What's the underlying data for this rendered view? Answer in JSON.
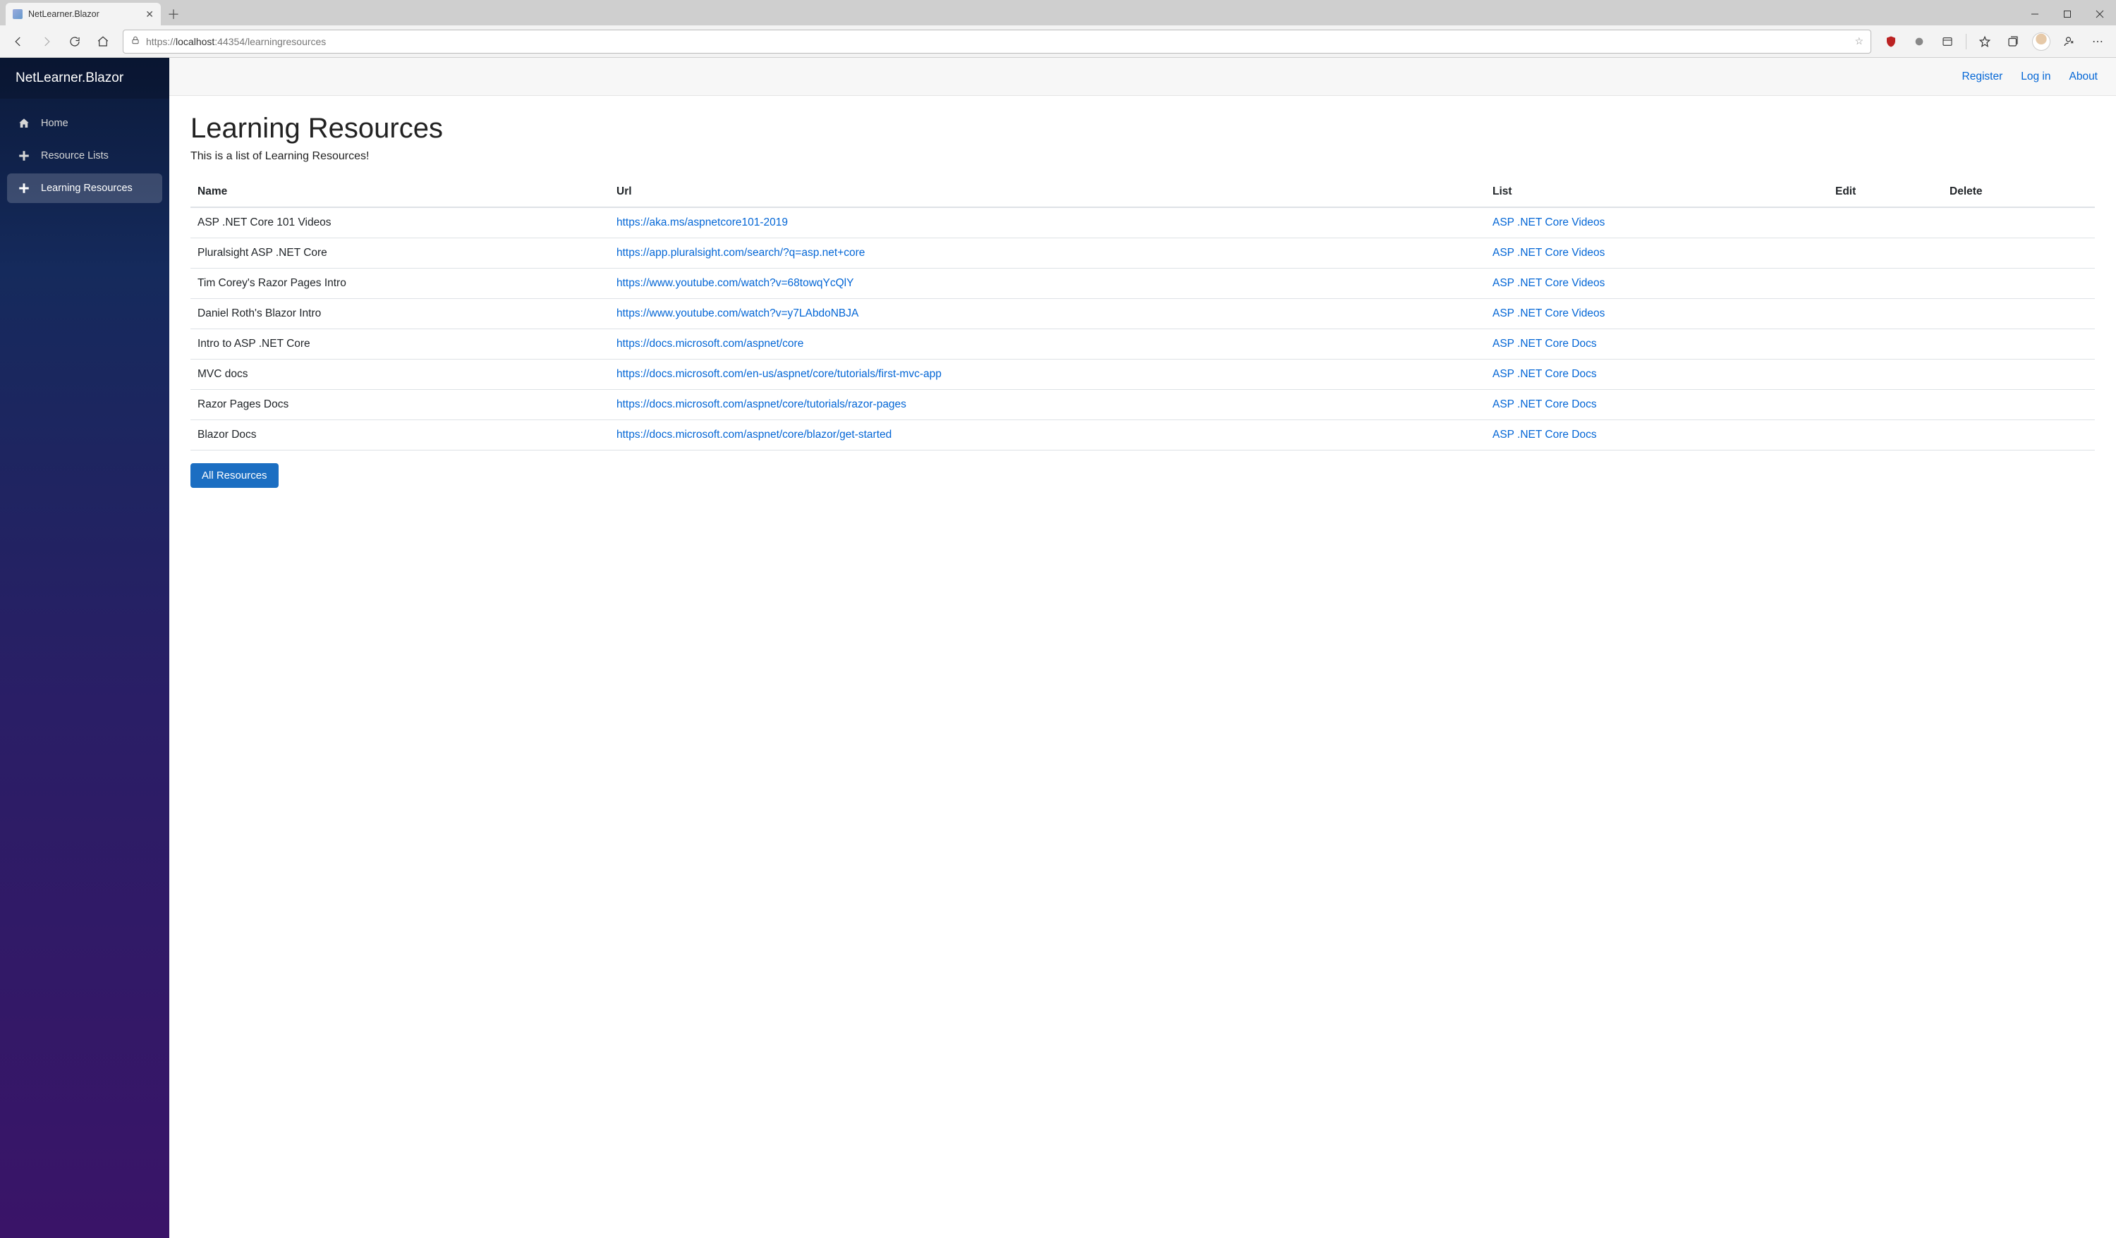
{
  "browser": {
    "tab_title": "NetLearner.Blazor",
    "url_scheme": "https://",
    "url_host": "localhost",
    "url_port": ":44354",
    "url_path": "/learningresources"
  },
  "sidebar": {
    "brand": "NetLearner.Blazor",
    "items": [
      {
        "label": "Home"
      },
      {
        "label": "Resource Lists"
      },
      {
        "label": "Learning Resources"
      }
    ]
  },
  "topbar": {
    "register": "Register",
    "login": "Log in",
    "about": "About"
  },
  "page": {
    "title": "Learning Resources",
    "subtitle": "This is a list of Learning Resources!",
    "columns": {
      "name": "Name",
      "url": "Url",
      "list": "List",
      "edit": "Edit",
      "delete": "Delete"
    },
    "rows": [
      {
        "name": "ASP .NET Core 101 Videos",
        "url": "https://aka.ms/aspnetcore101-2019",
        "list": "ASP .NET Core Videos"
      },
      {
        "name": "Pluralsight ASP .NET Core",
        "url": "https://app.pluralsight.com/search/?q=asp.net+core",
        "list": "ASP .NET Core Videos"
      },
      {
        "name": "Tim Corey's Razor Pages Intro",
        "url": "https://www.youtube.com/watch?v=68towqYcQlY",
        "list": "ASP .NET Core Videos"
      },
      {
        "name": "Daniel Roth's Blazor Intro",
        "url": "https://www.youtube.com/watch?v=y7LAbdoNBJA",
        "list": "ASP .NET Core Videos"
      },
      {
        "name": "Intro to ASP .NET Core",
        "url": "https://docs.microsoft.com/aspnet/core",
        "list": "ASP .NET Core Docs"
      },
      {
        "name": "MVC docs",
        "url": "https://docs.microsoft.com/en-us/aspnet/core/tutorials/first-mvc-app",
        "list": "ASP .NET Core Docs"
      },
      {
        "name": "Razor Pages Docs",
        "url": "https://docs.microsoft.com/aspnet/core/tutorials/razor-pages",
        "list": "ASP .NET Core Docs"
      },
      {
        "name": "Blazor Docs",
        "url": "https://docs.microsoft.com/aspnet/core/blazor/get-started",
        "list": "ASP .NET Core Docs"
      }
    ],
    "all_button": "All Resources"
  }
}
